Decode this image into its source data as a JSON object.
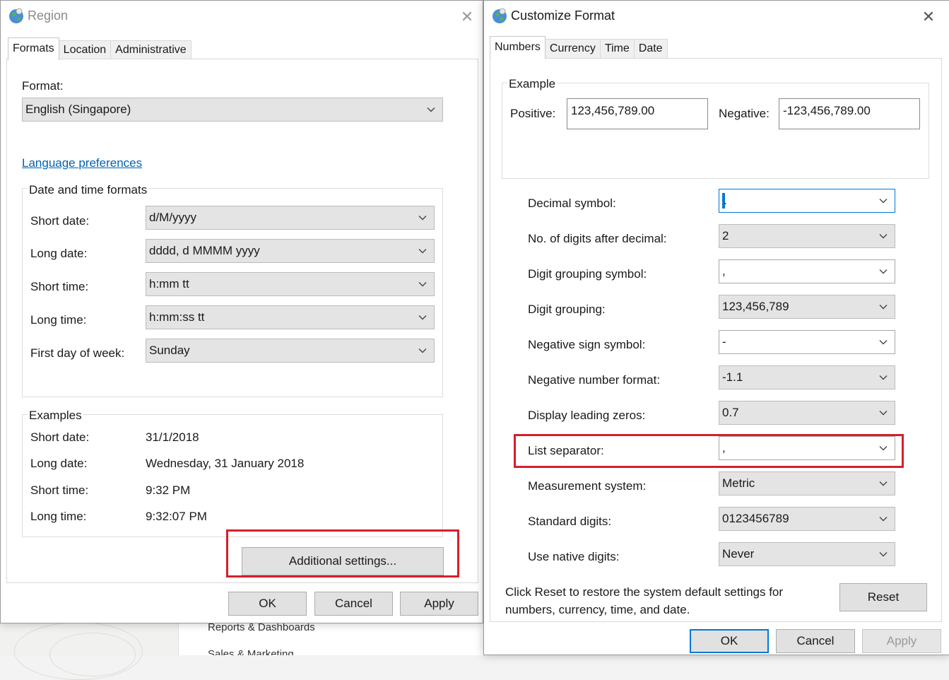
{
  "background_app": {
    "menu_items": [
      "Reports & Dashboards",
      "Sales & Marketing"
    ]
  },
  "region_window": {
    "title": "Region",
    "tabs": [
      "Formats",
      "Location",
      "Administrative"
    ],
    "format_label": "Format:",
    "format_value": "English (Singapore)",
    "language_link": "Language preferences",
    "date_time_group": {
      "title": "Date and time formats",
      "rows": [
        {
          "label": "Short date:",
          "value": "d/M/yyyy"
        },
        {
          "label": "Long date:",
          "value": "dddd, d MMMM yyyy"
        },
        {
          "label": "Short time:",
          "value": "h:mm tt"
        },
        {
          "label": "Long time:",
          "value": "h:mm:ss tt"
        },
        {
          "label": "First day of week:",
          "value": "Sunday"
        }
      ]
    },
    "examples_group": {
      "title": "Examples",
      "rows": [
        {
          "label": "Short date:",
          "value": "31/1/2018"
        },
        {
          "label": "Long date:",
          "value": "Wednesday, 31 January 2018"
        },
        {
          "label": "Short time:",
          "value": "9:32 PM"
        },
        {
          "label": "Long time:",
          "value": "9:32:07 PM"
        }
      ]
    },
    "additional_settings_button": "Additional settings...",
    "ok": "OK",
    "cancel": "Cancel",
    "apply": "Apply"
  },
  "customize_window": {
    "title": "Customize Format",
    "tabs": [
      "Numbers",
      "Currency",
      "Time",
      "Date"
    ],
    "example": {
      "title": "Example",
      "positive_label": "Positive:",
      "positive_value": "123,456,789.00",
      "negative_label": "Negative:",
      "negative_value": "-123,456,789.00"
    },
    "settings": [
      {
        "label": "Decimal symbol:",
        "value": "."
      },
      {
        "label": "No. of digits after decimal:",
        "value": "2"
      },
      {
        "label": "Digit grouping symbol:",
        "value": ","
      },
      {
        "label": "Digit grouping:",
        "value": "123,456,789"
      },
      {
        "label": "Negative sign symbol:",
        "value": "-"
      },
      {
        "label": "Negative number format:",
        "value": "-1.1"
      },
      {
        "label": "Display leading zeros:",
        "value": "0.7"
      },
      {
        "label": "List separator:",
        "value": ","
      },
      {
        "label": "Measurement system:",
        "value": "Metric"
      },
      {
        "label": "Standard digits:",
        "value": "0123456789"
      },
      {
        "label": "Use native digits:",
        "value": "Never"
      }
    ],
    "reset_note": "Click Reset to restore the system default settings for numbers, currency, time, and date.",
    "reset_button": "Reset",
    "ok": "OK",
    "cancel": "Cancel",
    "apply": "Apply"
  },
  "colors": {
    "highlight": "#d4202b",
    "accent": "#0078d7",
    "link": "#0063b1"
  }
}
